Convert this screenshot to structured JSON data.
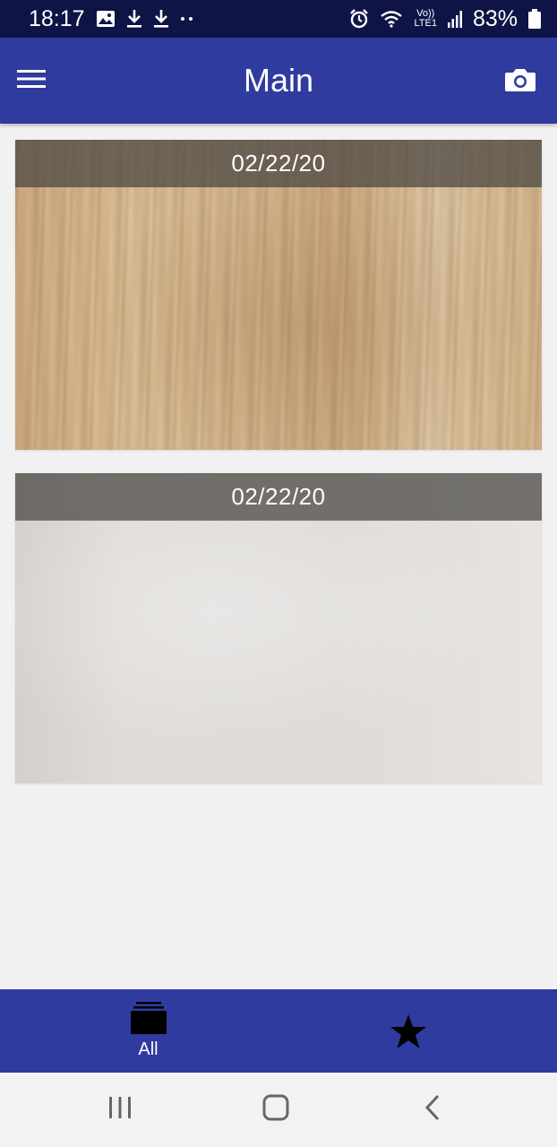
{
  "status_bar": {
    "time": "18:17",
    "volte_top": "Vo))",
    "volte_bottom": "LTE1",
    "battery": "83%"
  },
  "app_bar": {
    "title": "Main",
    "menu_icon": "hamburger-menu-icon",
    "camera_icon": "camera-icon"
  },
  "photos": [
    {
      "date": "02/22/20",
      "image": "wood-floor-photo"
    },
    {
      "date": "02/22/20",
      "image": "white-wall-photo"
    }
  ],
  "bottom_nav": {
    "all_label": "All",
    "all_icon": "albums-icon",
    "favorites_icon": "star-icon"
  },
  "colors": {
    "primary": "#2f3b9e",
    "status_bar": "#0f1447",
    "background": "#f1f1f1"
  }
}
